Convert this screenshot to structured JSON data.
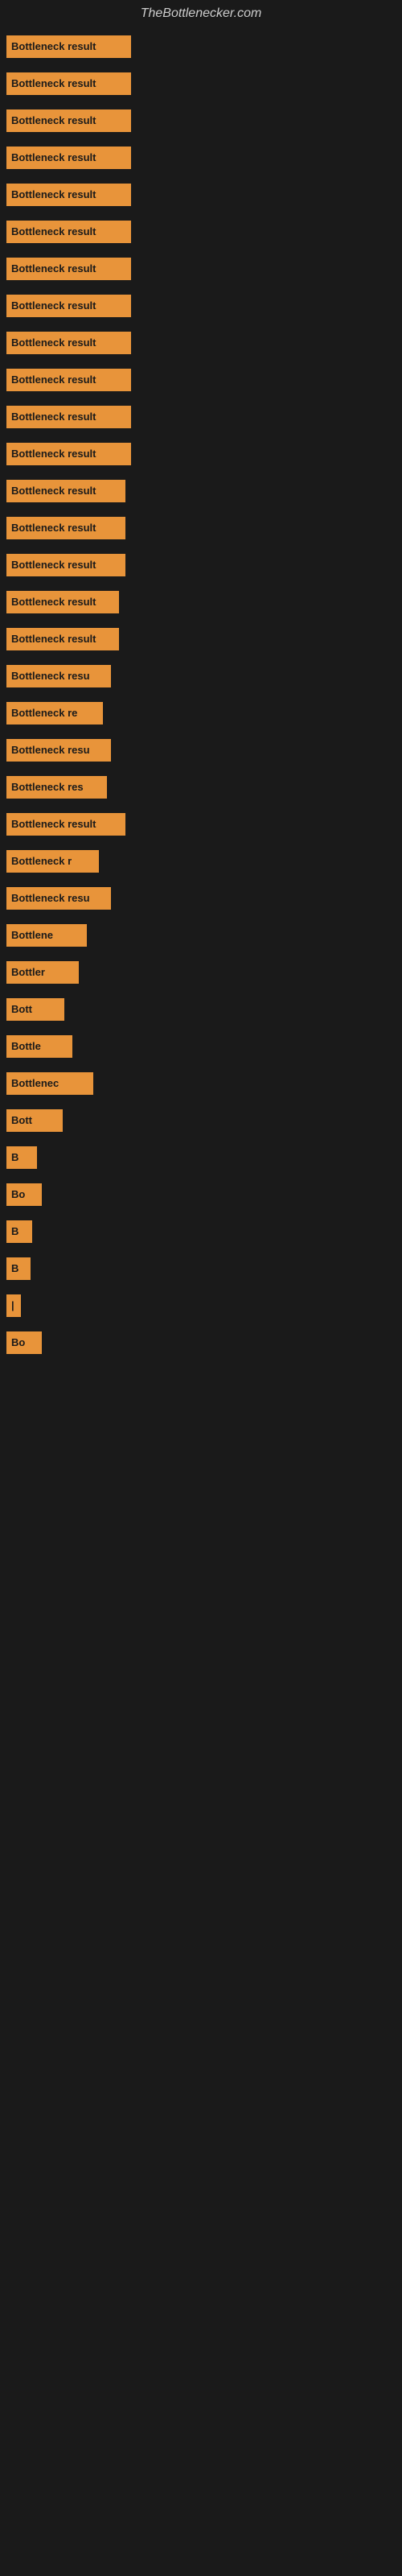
{
  "header": {
    "title": "TheBottlenecker.com"
  },
  "bars": [
    {
      "label": "Bottleneck result",
      "width": 155
    },
    {
      "label": "Bottleneck result",
      "width": 155
    },
    {
      "label": "Bottleneck result",
      "width": 155
    },
    {
      "label": "Bottleneck result",
      "width": 155
    },
    {
      "label": "Bottleneck result",
      "width": 155
    },
    {
      "label": "Bottleneck result",
      "width": 155
    },
    {
      "label": "Bottleneck result",
      "width": 155
    },
    {
      "label": "Bottleneck result",
      "width": 155
    },
    {
      "label": "Bottleneck result",
      "width": 155
    },
    {
      "label": "Bottleneck result",
      "width": 155
    },
    {
      "label": "Bottleneck result",
      "width": 155
    },
    {
      "label": "Bottleneck result",
      "width": 155
    },
    {
      "label": "Bottleneck result",
      "width": 148
    },
    {
      "label": "Bottleneck result",
      "width": 148
    },
    {
      "label": "Bottleneck result",
      "width": 148
    },
    {
      "label": "Bottleneck result",
      "width": 140
    },
    {
      "label": "Bottleneck result",
      "width": 140
    },
    {
      "label": "Bottleneck resu",
      "width": 130
    },
    {
      "label": "Bottleneck re",
      "width": 120
    },
    {
      "label": "Bottleneck resu",
      "width": 130
    },
    {
      "label": "Bottleneck res",
      "width": 125
    },
    {
      "label": "Bottleneck result",
      "width": 148
    },
    {
      "label": "Bottleneck r",
      "width": 115
    },
    {
      "label": "Bottleneck resu",
      "width": 130
    },
    {
      "label": "Bottlene",
      "width": 100
    },
    {
      "label": "Bottler",
      "width": 90
    },
    {
      "label": "Bott",
      "width": 72
    },
    {
      "label": "Bottle",
      "width": 82
    },
    {
      "label": "Bottlenec",
      "width": 108
    },
    {
      "label": "Bott",
      "width": 70
    },
    {
      "label": "B",
      "width": 38
    },
    {
      "label": "Bo",
      "width": 44
    },
    {
      "label": "B",
      "width": 32
    },
    {
      "label": "B",
      "width": 30
    },
    {
      "label": "|",
      "width": 18
    },
    {
      "label": "Bo",
      "width": 44
    }
  ]
}
